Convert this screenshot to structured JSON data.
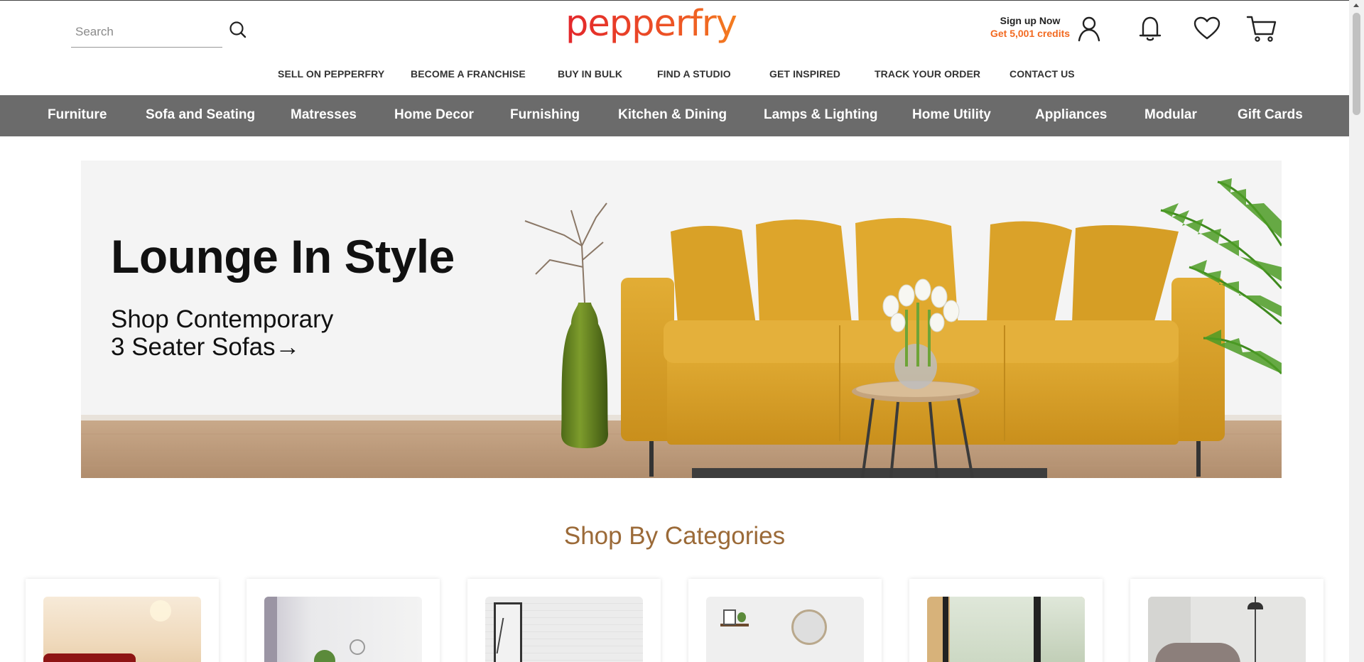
{
  "header": {
    "search_placeholder": "Search",
    "logo_text": "pepperfry",
    "signup_line1": "Sign up Now",
    "signup_line2": "Get 5,001 credits"
  },
  "top_nav": [
    "SELL ON PEPPERFRY",
    "BECOME A FRANCHISE",
    "BUY IN BULK",
    "FIND A STUDIO",
    "GET INSPIRED",
    "TRACK YOUR ORDER",
    "CONTACT US"
  ],
  "categories_bar": [
    "Furniture",
    "Sofa and Seating",
    "Matresses",
    "Home Decor",
    "Furnishing",
    "Kitchen & Dining",
    "Lamps & Lighting",
    "Home Utility",
    "Appliances",
    "Modular",
    "Gift Cards"
  ],
  "banner": {
    "title": "Lounge In Style",
    "subtitle_line1": "Shop Contemporary",
    "subtitle_line2": "3 Seater Sofas→"
  },
  "section": {
    "title": "Shop By Categories"
  },
  "colors": {
    "brand": "#ee5a24",
    "credits": "#f26a21",
    "category_bar": "#6b6b6b",
    "section_title": "#9b6a38",
    "sofa": "#d9a127"
  },
  "icons": {
    "search": "search-icon",
    "account": "user-icon",
    "notifications": "bell-icon",
    "wishlist": "heart-icon",
    "cart": "cart-icon"
  }
}
